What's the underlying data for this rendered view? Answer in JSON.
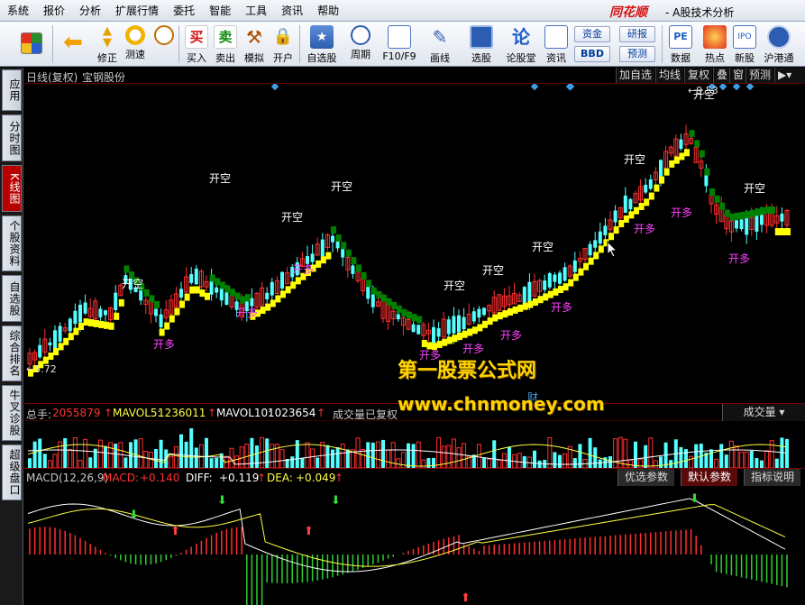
{
  "menu": {
    "items": [
      "系统",
      "报价",
      "分析",
      "扩展行情",
      "委托",
      "智能",
      "工具",
      "资讯",
      "帮助"
    ],
    "brand": "同花顺",
    "title": "- A股技术分析"
  },
  "toolbar": {
    "buttons": [
      {
        "label": "",
        "icon": "windows-grid-icon"
      },
      {
        "label": "",
        "icon": "back-arrow-icon"
      },
      {
        "label": "修正",
        "icon": "up-down-arrows-icon"
      },
      {
        "label": "测速",
        "icon": "speed-clock-icon"
      },
      {
        "label": "买入",
        "icon": "buy-char-icon",
        "char": "买"
      },
      {
        "label": "卖出",
        "icon": "sell-char-icon",
        "char": "卖"
      },
      {
        "label": "模拟",
        "icon": "hammer-icon"
      },
      {
        "label": "开户",
        "icon": "lock-icon"
      },
      {
        "label": "自选股",
        "icon": "star-folder-icon"
      },
      {
        "label": "周期",
        "icon": "clock-period-icon"
      },
      {
        "label": "F10/F9",
        "icon": "f10-document-icon"
      },
      {
        "label": "画线",
        "icon": "pencil-icon"
      },
      {
        "label": "选股",
        "icon": "screen-select-icon"
      },
      {
        "label": "论股堂",
        "icon": "lun-char-icon",
        "char": "论"
      },
      {
        "label": "资讯",
        "icon": "news-document-icon"
      },
      {
        "label": "数据",
        "icon": "pe-data-icon",
        "char": "PE"
      },
      {
        "label": "热点",
        "icon": "hot-topic-icon"
      },
      {
        "label": "新股",
        "icon": "ipo-icon",
        "char": "IPO"
      },
      {
        "label": "沪港通",
        "icon": "sse-hke-icon"
      }
    ],
    "pills": [
      "资金",
      "研报",
      "BBD",
      "预测"
    ]
  },
  "sidebar": {
    "tabs": [
      "应用",
      "分时图",
      "K线图",
      "个股资料",
      "自选股",
      "综合排名",
      "牛叉诊股",
      "超级盘口"
    ]
  },
  "kline": {
    "period": "日线(复权)",
    "stock": "宝钢股份",
    "buttons": [
      "加自选",
      "均线",
      "复权",
      "叠",
      "窗",
      "预测"
    ],
    "high_label": "9.53",
    "low_label": "5.72",
    "signals_kaikong": "开空",
    "signals_kaiduo": "开多",
    "fin_marker": "财"
  },
  "volume": {
    "label": "总手:",
    "total": "2055879",
    "mavol5_label": "MAVOL5:",
    "mavol5": "1236011",
    "mavol10_label": "MAVOL10:",
    "mavol10": "1023654",
    "note": "成交量已复权",
    "selector": "成交量"
  },
  "macd": {
    "name": "MACD(12,26,9)",
    "macd_label": "MACD:",
    "macd_value": "+0.140",
    "diff_label": "DIFF:",
    "diff_value": "+0.119",
    "dea_label": "DEA:",
    "dea_value": "+0.049",
    "buttons": [
      "优选参数",
      "默认参数",
      "指标说明"
    ]
  },
  "watermark": {
    "line1": "第一股票公式网",
    "line2": "www.chnmoney.com"
  },
  "colors": {
    "up": "#ff3030",
    "down": "#54ffff",
    "support": "#ffff00",
    "resistance": "#008000",
    "kaikong": "#ffffff",
    "kaiduo": "#ff40ff"
  }
}
